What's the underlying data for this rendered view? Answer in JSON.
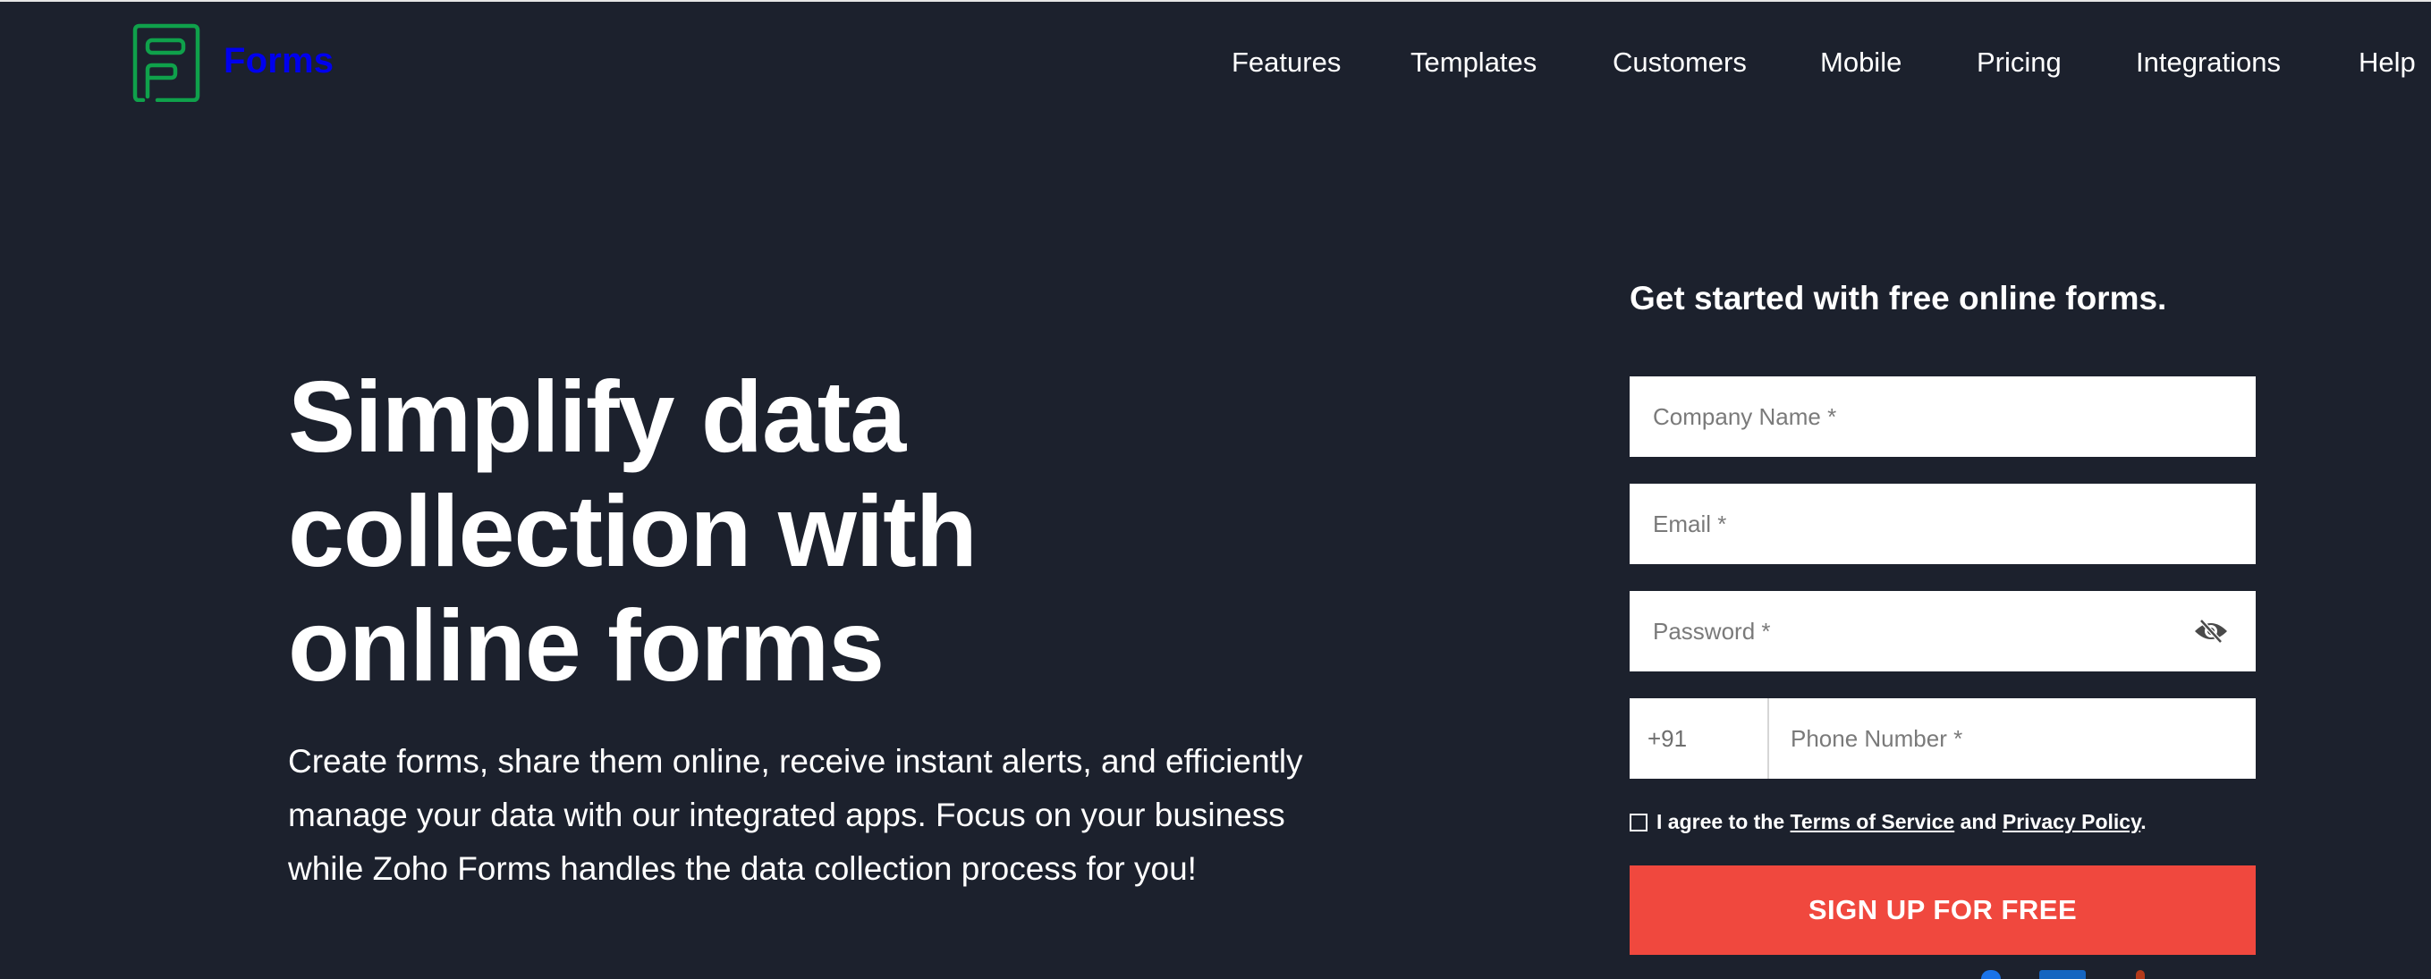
{
  "header": {
    "brand": "Forms",
    "logo_icon": "zoho-forms-logo-icon",
    "logo_color": "#0fa14b",
    "nav": [
      {
        "label": "Features"
      },
      {
        "label": "Templates"
      },
      {
        "label": "Customers"
      },
      {
        "label": "Mobile"
      },
      {
        "label": "Pricing"
      },
      {
        "label": "Integrations"
      },
      {
        "label": "Help"
      }
    ]
  },
  "hero": {
    "headline_lines": [
      "Simplify data",
      "collection with",
      "online forms"
    ],
    "subtext": "Create forms, share them online, receive instant alerts, and efficiently manage your data with our integrated apps. Focus on your business while Zoho Forms handles the data collection process for you!"
  },
  "signup_form": {
    "title": "Get started with free online forms.",
    "company_placeholder": "Company Name *",
    "email_placeholder": "Email *",
    "password_placeholder": "Password *",
    "password_toggle_icon": "eye-slash-icon",
    "country_code": "+91",
    "phone_placeholder": "Phone Number *",
    "consent": {
      "checked": false,
      "prefix": "I agree to the ",
      "terms_link": "Terms of Service",
      "middle": " and ",
      "privacy_link": "Privacy Policy",
      "suffix": "."
    },
    "submit_label": "SIGN UP FOR FREE",
    "submit_color": "#f0483e"
  },
  "theme": {
    "background": "#1c212d",
    "text": "#ffffff"
  }
}
